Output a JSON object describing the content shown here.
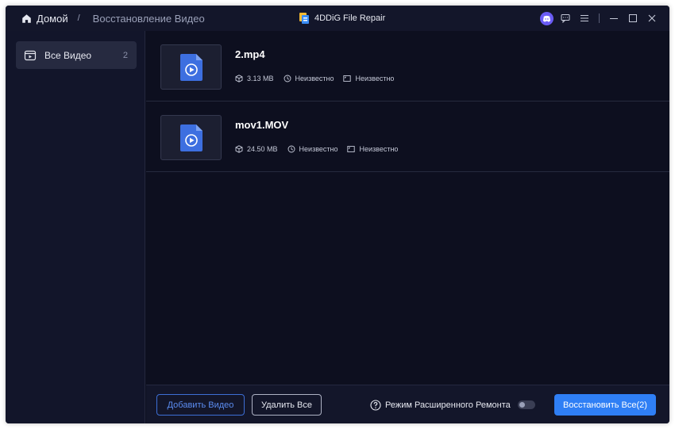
{
  "breadcrumb": {
    "home_label": "Домой",
    "separator": "/",
    "current": "Восстановление Видео"
  },
  "app": {
    "title": "4DDiG File Repair"
  },
  "sidebar": {
    "items": [
      {
        "label": "Все Видео",
        "count": "2"
      }
    ]
  },
  "files": [
    {
      "name": "2.mp4",
      "size": "3.13 MB",
      "duration": "Неизвестно",
      "resolution": "Неизвестно"
    },
    {
      "name": "mov1.MOV",
      "size": "24.50 MB",
      "duration": "Неизвестно",
      "resolution": "Неизвестно"
    }
  ],
  "bottombar": {
    "add_label": "Добавить Видео",
    "delete_label": "Удалить Все",
    "advanced_label": "Режим Расширенного Ремонта",
    "repair_label": "Восстановить Все(2)"
  },
  "colors": {
    "accent": "#2f7ff5",
    "background": "#0d0f1f",
    "sidebar_active": "#262a40",
    "file_icon": "#3d6fe0"
  },
  "icons": [
    "home-icon",
    "discord-icon",
    "feedback-icon",
    "menu-icon",
    "minimize-icon",
    "maximize-icon",
    "close-icon",
    "video-folder-icon",
    "video-file-icon",
    "box-icon",
    "clock-icon",
    "resolution-icon",
    "help-icon"
  ]
}
